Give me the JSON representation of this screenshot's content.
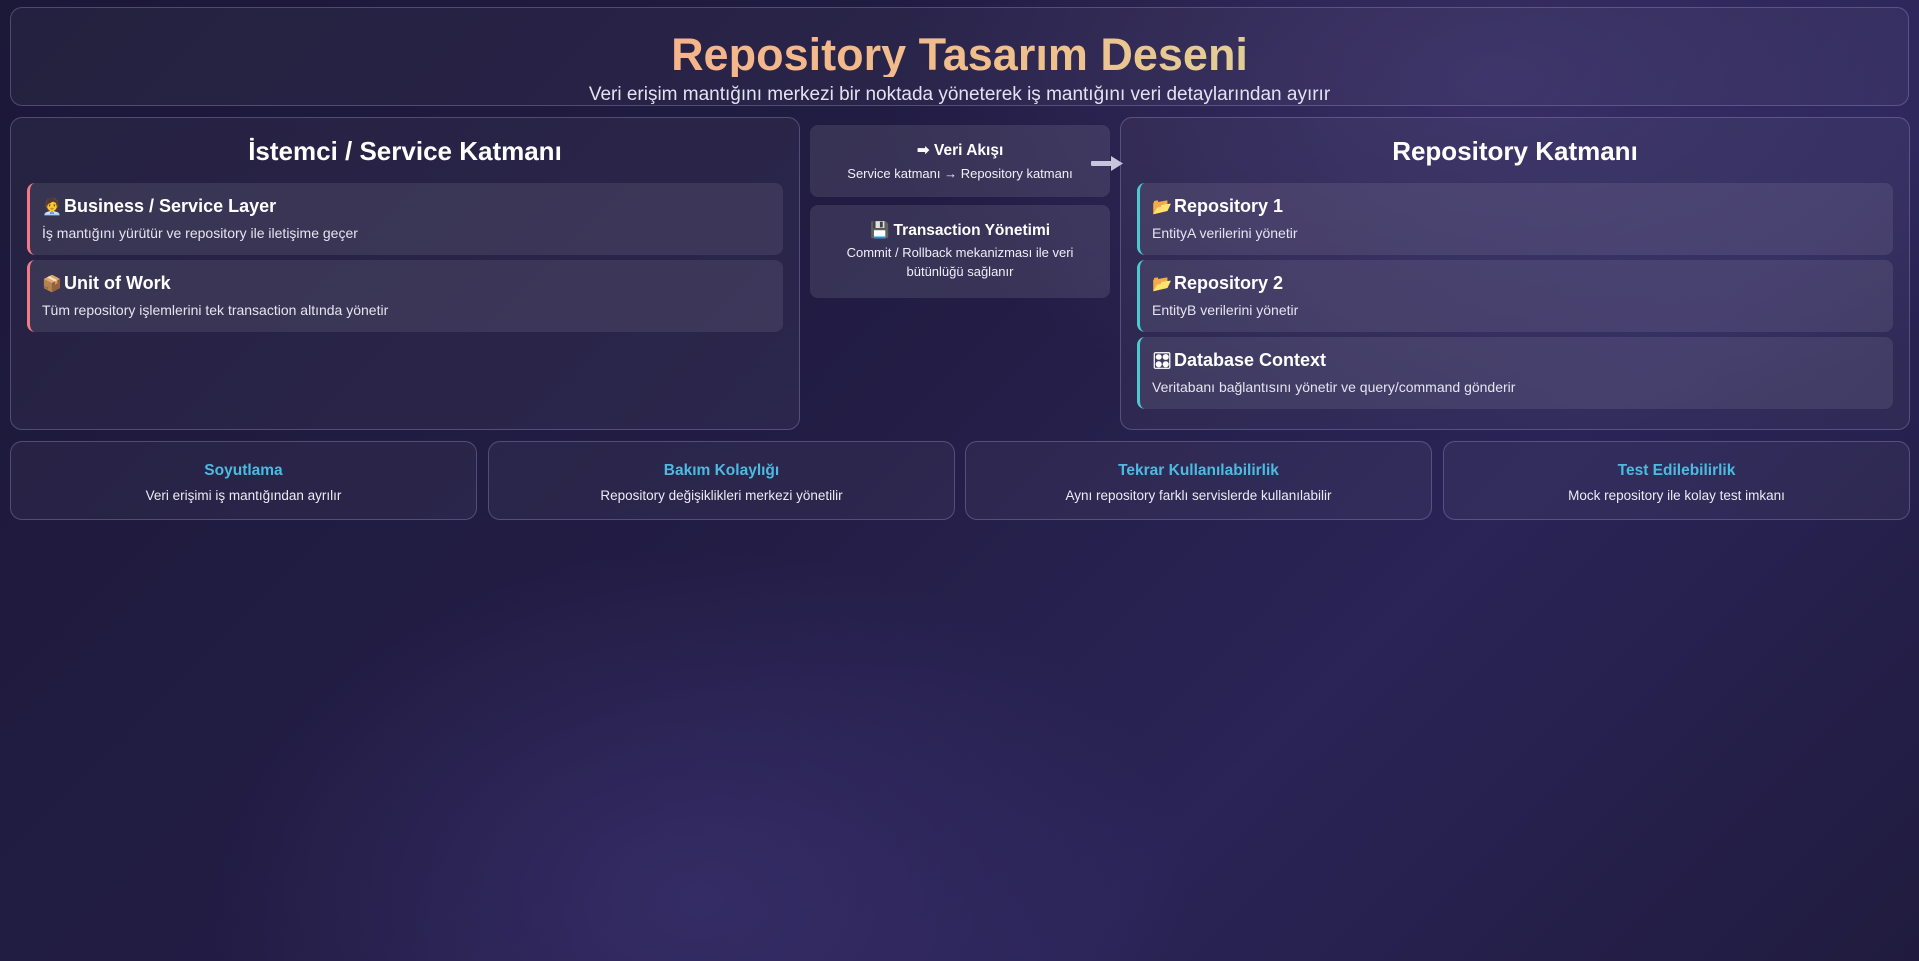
{
  "header": {
    "title": "Repository Tasarım Deseni",
    "subtitle": "Veri erişim mantığını merkezi bir noktada yöneterek iş mantığını veri detaylarından ayırır"
  },
  "client_layer": {
    "title": "İstemci / Service Katmanı",
    "cards": [
      {
        "icon": "🧑‍💼",
        "title": "Business / Service Layer",
        "desc": "İş mantığını yürütür ve repository ile iletişime geçer"
      },
      {
        "icon": "📦",
        "title": "Unit of Work",
        "desc": "Tüm repository işlemlerini tek transaction altında yönetir"
      }
    ]
  },
  "middle": {
    "flow": {
      "title": "➡ Veri Akışı",
      "desc": "Service katmanı → Repository katmanı"
    },
    "transaction": {
      "title": "💾 Transaction Yönetimi",
      "desc": "Commit / Rollback mekanizması ile veri bütünlüğü sağlanır"
    }
  },
  "repository_layer": {
    "title": "Repository Katmanı",
    "cards": [
      {
        "icon": "📂",
        "title": "Repository 1",
        "desc": "EntityA verilerini yönetir"
      },
      {
        "icon": "📂",
        "title": "Repository 2",
        "desc": "EntityB verilerini yönetir"
      },
      {
        "icon": "🎛",
        "title": "Database Context",
        "desc": "Veritabanı bağlantısını yönetir ve query/command gönderir"
      }
    ]
  },
  "benefits": [
    {
      "title": "Soyutlama",
      "desc": "Veri erişimi iş mantığından ayrılır"
    },
    {
      "title": "Bakım Kolaylığı",
      "desc": "Repository değişiklikleri merkezi yönetilir"
    },
    {
      "title": "Tekrar Kullanılabilirlik",
      "desc": "Aynı repository farklı servislerde kullanılabilir"
    },
    {
      "title": "Test Edilebilirlik",
      "desc": "Mock repository ile kolay test imkanı"
    }
  ],
  "colors": {
    "client_accent": "#f07a86",
    "repository_accent": "#4fc7cf",
    "benefit_title": "#4cbbe0",
    "title_gradient_start": "#f7b08a",
    "title_gradient_end": "#cfe0a6"
  }
}
